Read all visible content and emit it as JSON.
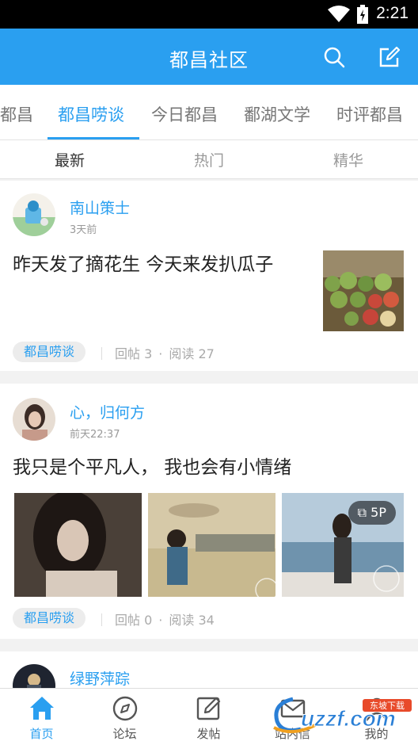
{
  "status_bar": {
    "time": "2:21"
  },
  "header": {
    "title": "都昌社区"
  },
  "channel_tabs": [
    "都昌",
    "都昌唠谈",
    "今日都昌",
    "鄱湖文学",
    "时评都昌"
  ],
  "sub_tabs": [
    "最新",
    "热门",
    "精华"
  ],
  "posts": [
    {
      "author": "南山策士",
      "time": "3天前",
      "title": "昨天发了摘花生 今天来发扒瓜子",
      "tag": "都昌唠谈",
      "replies": "回帖 3",
      "reads": "阅读 27"
    },
    {
      "author": "心，归何方",
      "time": "前天22:37",
      "title": "我只是个平凡人， 我也会有小情绪",
      "tag": "都昌唠谈",
      "replies": "回帖 0",
      "reads": "阅读 34",
      "photo_count": "5P"
    },
    {
      "author": "绿野萍踪"
    }
  ],
  "bottom_nav": [
    "首页",
    "论坛",
    "发帖",
    "站内信",
    "我的"
  ],
  "watermark": {
    "main": "uzzf.com",
    "badge": "东坡下载"
  },
  "colors": {
    "accent": "#2a9ff0",
    "status_bar": "#000000"
  },
  "icons": {
    "search": "search-icon",
    "compose": "compose-icon",
    "home": "home-icon",
    "forum": "compass-icon",
    "post": "edit-icon"
  }
}
